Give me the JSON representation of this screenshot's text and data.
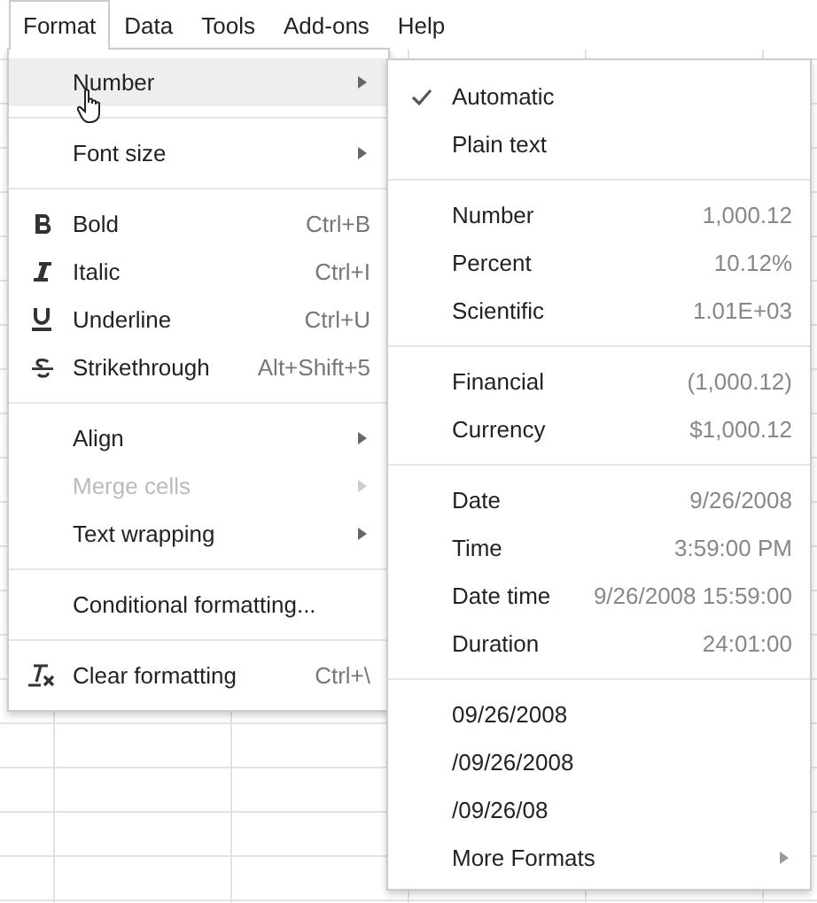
{
  "menubar": [
    {
      "label": "Format",
      "selected": true
    },
    {
      "label": "Data",
      "selected": false
    },
    {
      "label": "Tools",
      "selected": false
    },
    {
      "label": "Add-ons",
      "selected": false
    },
    {
      "label": "Help",
      "selected": false
    }
  ],
  "format_menu": [
    [
      {
        "label": "Number",
        "submenu": true,
        "selected": true,
        "disabled": false
      }
    ],
    [
      {
        "label": "Font size",
        "submenu": true,
        "selected": false,
        "disabled": false
      }
    ],
    [
      {
        "label": "Bold",
        "kind": "bold",
        "shortcut": "Ctrl+B",
        "submenu": false,
        "selected": false,
        "disabled": false
      },
      {
        "label": "Italic",
        "kind": "italic",
        "shortcut": "Ctrl+I",
        "submenu": false,
        "selected": false,
        "disabled": false
      },
      {
        "label": "Underline",
        "kind": "underline",
        "shortcut": "Ctrl+U",
        "submenu": false,
        "selected": false,
        "disabled": false
      },
      {
        "label": "Strikethrough",
        "kind": "strikethrough",
        "shortcut": "Alt+Shift+5",
        "submenu": false,
        "selected": false,
        "disabled": false
      }
    ],
    [
      {
        "label": "Align",
        "submenu": true,
        "selected": false,
        "disabled": false
      },
      {
        "label": "Merge cells",
        "submenu": true,
        "selected": false,
        "disabled": true
      },
      {
        "label": "Text wrapping",
        "submenu": true,
        "selected": false,
        "disabled": false
      }
    ],
    [
      {
        "label": "Conditional formatting...",
        "submenu": false,
        "selected": false,
        "disabled": false
      }
    ],
    [
      {
        "label": "Clear formatting",
        "kind": "clear",
        "shortcut": "Ctrl+\\",
        "submenu": false,
        "selected": false,
        "disabled": false
      }
    ]
  ],
  "number_submenu": [
    [
      {
        "label": "Automatic",
        "checked": true,
        "submenu": false
      },
      {
        "label": "Plain text",
        "checked": false,
        "submenu": false
      }
    ],
    [
      {
        "label": "Number",
        "value": "1,000.12",
        "checked": false,
        "submenu": false
      },
      {
        "label": "Percent",
        "value": "10.12%",
        "checked": false,
        "submenu": false
      },
      {
        "label": "Scientific",
        "value": "1.01E+03",
        "checked": false,
        "submenu": false
      }
    ],
    [
      {
        "label": "Financial",
        "value": "(1,000.12)",
        "checked": false,
        "submenu": false
      },
      {
        "label": "Currency",
        "value": "$1,000.12",
        "checked": false,
        "submenu": false
      }
    ],
    [
      {
        "label": "Date",
        "value": "9/26/2008",
        "checked": false,
        "submenu": false
      },
      {
        "label": "Time",
        "value": "3:59:00 PM",
        "checked": false,
        "submenu": false
      },
      {
        "label": "Date time",
        "value": "9/26/2008 15:59:00",
        "checked": false,
        "submenu": false
      },
      {
        "label": "Duration",
        "value": "24:01:00",
        "checked": false,
        "submenu": false
      }
    ],
    [
      {
        "label": "09/26/2008",
        "checked": false,
        "submenu": false
      },
      {
        "label": "/09/26/2008",
        "checked": false,
        "submenu": false
      },
      {
        "label": "/09/26/08",
        "checked": false,
        "submenu": false
      },
      {
        "label": "More Formats",
        "checked": false,
        "submenu": true
      }
    ]
  ]
}
